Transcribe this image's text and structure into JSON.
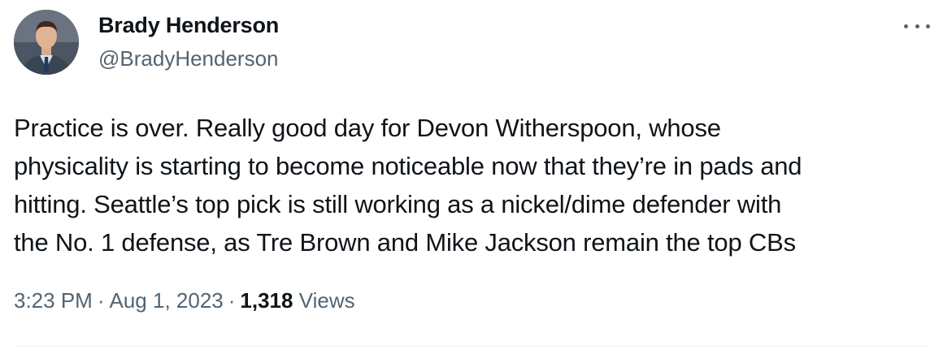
{
  "author": {
    "display_name": "Brady Henderson",
    "handle": "@BradyHenderson"
  },
  "tweet": {
    "lines": [
      "Practice is over. Really good day for Devon Witherspoon, whose",
      "physicality is starting to become noticeable now that they’re in pads and",
      "hitting. Seattle’s top pick is still working as a nickel/dime defender with",
      "the No. 1 defense, as Tre Brown and Mike Jackson remain the top CBs"
    ]
  },
  "meta": {
    "time": "3:23 PM",
    "separator": "·",
    "date": "Aug 1, 2023",
    "views_count": "1,318",
    "views_label": "Views"
  },
  "icons": {
    "more": "more-horizontal-icon",
    "avatar": "profile-photo"
  },
  "colors": {
    "text_primary": "#0f1419",
    "text_secondary": "#536471",
    "divider": "#eff3f4"
  }
}
